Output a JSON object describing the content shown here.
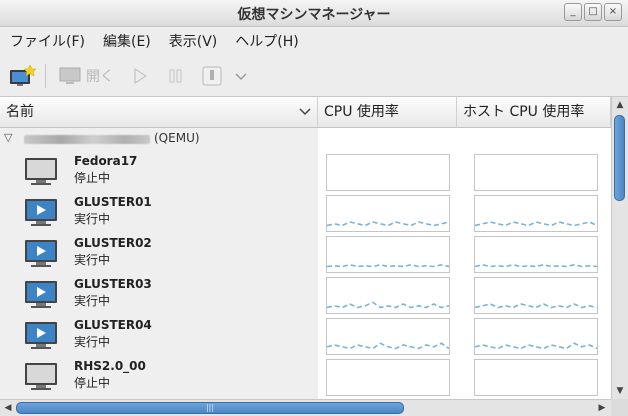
{
  "window": {
    "title": "仮想マシンマネージャー",
    "min": "_",
    "max": "□",
    "close": "×"
  },
  "menu": [
    "ファイル(F)",
    "編集(E)",
    "表示(V)",
    "ヘルプ(H)"
  ],
  "toolbar": {
    "open_label": "開く"
  },
  "columns": {
    "name": "名前",
    "cpu": "CPU 使用率",
    "host_cpu": "ホスト  CPU 使用率"
  },
  "connection": {
    "label": "(QEMU)"
  },
  "vms": [
    {
      "name": "Fedora17",
      "status": "停止中",
      "running": false,
      "cpu": [],
      "host": []
    },
    {
      "name": "GLUSTER01",
      "status": "実行中",
      "running": true,
      "cpu": [
        0.1,
        0.15,
        0.1,
        0.2,
        0.15,
        0.1,
        0.2,
        0.15,
        0.1,
        0.2,
        0.15,
        0.1,
        0.2,
        0.15,
        0.1,
        0.15,
        0.2
      ],
      "host": [
        0.1,
        0.15,
        0.2,
        0.15,
        0.1,
        0.2,
        0.15,
        0.1,
        0.2,
        0.15,
        0.1,
        0.2,
        0.15,
        0.1,
        0.15,
        0.2,
        0.1
      ]
    },
    {
      "name": "GLUSTER02",
      "status": "実行中",
      "running": true,
      "cpu": [
        0.1,
        0.12,
        0.1,
        0.15,
        0.1,
        0.12,
        0.1,
        0.15,
        0.1,
        0.12,
        0.1,
        0.15,
        0.1,
        0.12,
        0.1,
        0.15,
        0.1
      ],
      "host": [
        0.1,
        0.15,
        0.1,
        0.12,
        0.1,
        0.15,
        0.1,
        0.12,
        0.1,
        0.15,
        0.1,
        0.12,
        0.1,
        0.15,
        0.1,
        0.12,
        0.1
      ]
    },
    {
      "name": "GLUSTER03",
      "status": "実行中",
      "running": true,
      "cpu": [
        0.1,
        0.15,
        0.1,
        0.2,
        0.1,
        0.15,
        0.25,
        0.1,
        0.15,
        0.1,
        0.2,
        0.1,
        0.15,
        0.1,
        0.2,
        0.1,
        0.15
      ],
      "host": [
        0.1,
        0.15,
        0.2,
        0.1,
        0.15,
        0.1,
        0.2,
        0.15,
        0.1,
        0.2,
        0.1,
        0.15,
        0.1,
        0.2,
        0.1,
        0.15,
        0.1
      ]
    },
    {
      "name": "GLUSTER04",
      "status": "実行中",
      "running": true,
      "cpu": [
        0.15,
        0.2,
        0.15,
        0.1,
        0.2,
        0.15,
        0.1,
        0.25,
        0.15,
        0.1,
        0.2,
        0.15,
        0.1,
        0.2,
        0.15,
        0.25,
        0.1
      ],
      "host": [
        0.15,
        0.2,
        0.15,
        0.1,
        0.2,
        0.15,
        0.1,
        0.2,
        0.15,
        0.1,
        0.2,
        0.15,
        0.1,
        0.25,
        0.15,
        0.2,
        0.1
      ]
    },
    {
      "name": "RHS2.0_00",
      "status": "停止中",
      "running": false,
      "cpu": [],
      "host": []
    }
  ],
  "colors": {
    "graph_line": "#7ab3d8",
    "icon_running": "#3d84c7",
    "icon_stopped": "#d8d8d8"
  }
}
